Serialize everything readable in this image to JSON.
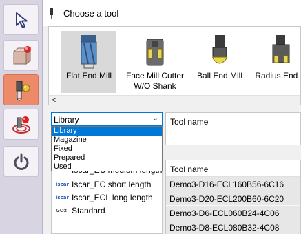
{
  "window": {
    "title": "Choose a tool"
  },
  "sidebar": {
    "buttons": [
      {
        "name": "select-arrow-icon",
        "active": false
      },
      {
        "name": "part-icon",
        "active": false
      },
      {
        "name": "tool-icon",
        "active": true
      },
      {
        "name": "toolpath-icon",
        "active": false
      },
      {
        "name": "power-icon",
        "active": false
      }
    ]
  },
  "gallery": {
    "tools": [
      {
        "label": "Flat End Mill",
        "selected": true
      },
      {
        "label_line1": "Face Mill Cutter",
        "label_line2": "W/O Shank",
        "selected": false
      },
      {
        "label": "Ball End Mill",
        "selected": false
      },
      {
        "label": "Radius End M",
        "selected": false
      }
    ],
    "scroll_left": "<"
  },
  "library_select": {
    "value": "Library",
    "options": [
      "Library",
      "Magazine",
      "Fixed",
      "Prepared",
      "Used"
    ],
    "highlighted": "Library"
  },
  "library_items": [
    {
      "icon": "iscar-icon",
      "label": "Iscar_EC medium length"
    },
    {
      "icon": "iscar-icon",
      "label": "Iscar_EC short length"
    },
    {
      "icon": "iscar-icon",
      "label": "Iscar_ECL long length"
    },
    {
      "icon": "standard-icon",
      "label": "Standard"
    }
  ],
  "icon_text": {
    "iscar": "iscar",
    "standard": "GOz"
  },
  "tool_name_top": {
    "header": "Tool name"
  },
  "tool_name_list": {
    "header": "Tool name",
    "rows": [
      "Demo3-D16-ECL160B56-6C16",
      "Demo3-D20-ECL200B60-6C20",
      "Demo3-D6-ECL060B24-4C06",
      "Demo3-D8-ECL080B32-4C08"
    ]
  },
  "colors": {
    "accent": "#0078d7",
    "active_sidebar": "#ec8a6a",
    "sidebar_bg": "#d9d4e2"
  }
}
